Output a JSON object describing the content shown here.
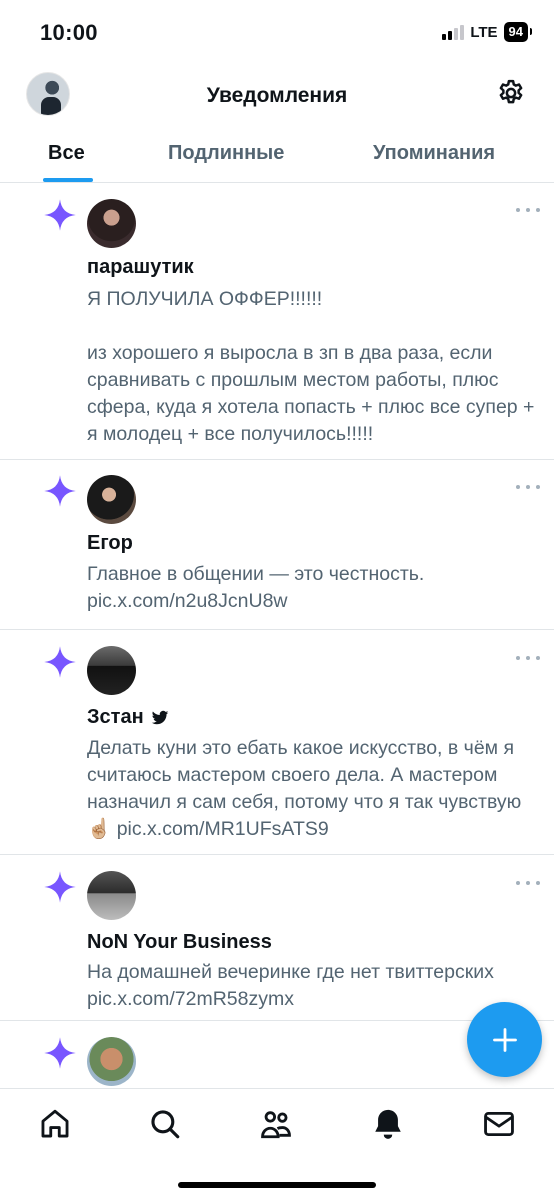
{
  "status_bar": {
    "time": "10:00",
    "network": "LTE",
    "battery": "94"
  },
  "header": {
    "title": "Уведомления",
    "avatar_icon": "user-avatar",
    "settings_icon": "gear-icon"
  },
  "tabs": [
    {
      "label": "Все",
      "active": true
    },
    {
      "label": "Подлинные",
      "active": false
    },
    {
      "label": "Упоминания",
      "active": false
    }
  ],
  "notifications": [
    {
      "icon": "sparkle-icon",
      "name": "парашутик",
      "verified": false,
      "text": "Я ПОЛУЧИЛА ОФФЕР!!!!!!\n\nиз хорошего я выросла в зп в два раза, если сравнивать с прошлым местом работы, плюс сфера, куда я хотела попасть + плюс все супер + я молодец + все получилось!!!!!"
    },
    {
      "icon": "sparkle-icon",
      "name": "Егор",
      "verified": false,
      "text": "Главное в общении — это честность. pic.x.com/n2u8JcnU8w"
    },
    {
      "icon": "sparkle-icon",
      "name": "Зстан",
      "verified": true,
      "text": "Делать куни это ебать какое искусство, в чём я считаюсь мастером своего дела. А мастером назначил я сам себя, потому что я так чувствую ☝🏼 pic.x.com/MR1UFsATS9"
    },
    {
      "icon": "sparkle-icon",
      "name": "NoN Your Business",
      "verified": false,
      "text": "На домашней вечеринке где нет твиттерских pic.x.com/72mR58zymx"
    },
    {
      "icon": "sparkle-icon",
      "name": "",
      "verified": false,
      "text": ""
    }
  ],
  "fab": {
    "icon": "plus-icon"
  },
  "bottom_nav": [
    "home-icon",
    "search-icon",
    "communities-icon",
    "bell-icon",
    "mail-icon"
  ],
  "colors": {
    "accent": "#1d9bf0",
    "sparkle": "#7856ff",
    "secondary_text": "#536471"
  }
}
